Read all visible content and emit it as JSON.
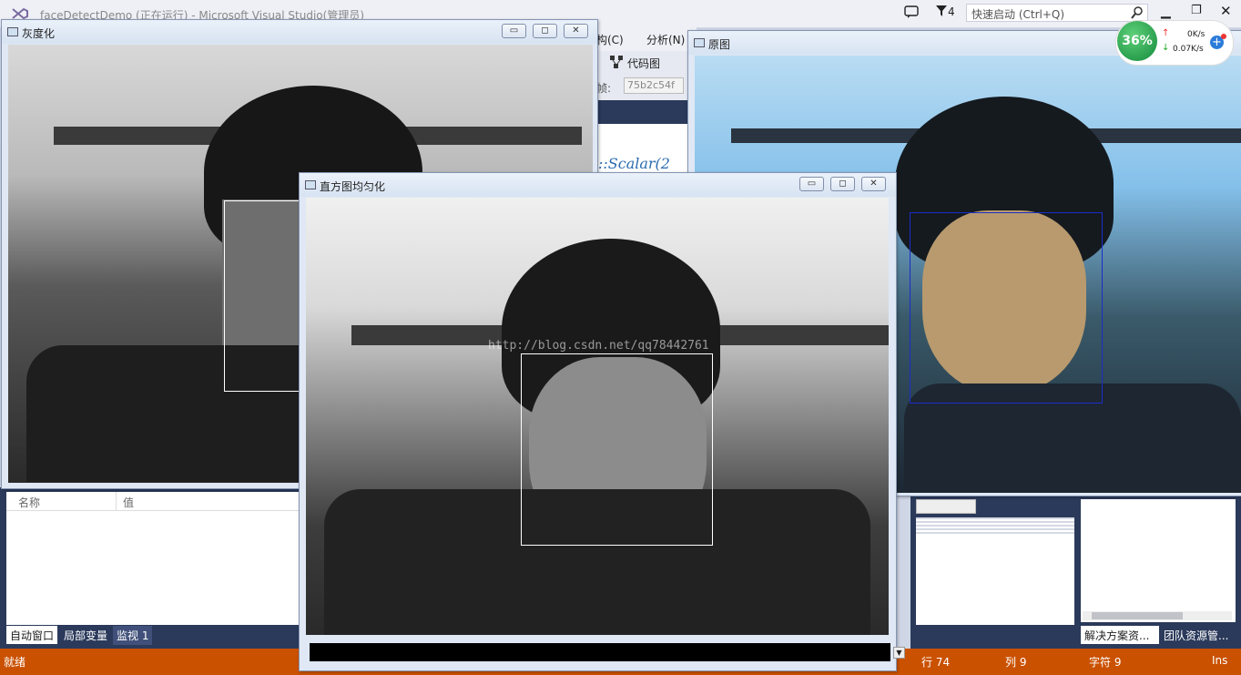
{
  "vs": {
    "title": "faceDetectDemo (正在运行) - Microsoft Visual Studio(管理员)",
    "menu_arch": "构(C)",
    "menu_analyze": "分析(N)",
    "code_map": "代码图",
    "frame_label": "帧:",
    "frame_value": "75b2c54f",
    "code_text": "::Scalar(2",
    "quick_launch_placeholder": "快速启动 (Ctrl+Q)",
    "filter_count": "4",
    "status": {
      "ready": "就绪",
      "line": "行 74",
      "col": "列 9",
      "char": "字符 9",
      "mode": "Ins"
    },
    "locals": {
      "col_name": "名称",
      "col_value": "值",
      "tabs": [
        "自动窗口",
        "局部变量",
        "监视 1"
      ]
    },
    "right_tabs": [
      "解决方案资...",
      "团队资源管..."
    ]
  },
  "netmon": {
    "percent": "36%",
    "up": "0K/s",
    "down": "0.07K/s"
  },
  "windows": {
    "gray": {
      "title": "灰度化"
    },
    "hist": {
      "title": "直方图均匀化"
    },
    "orig": {
      "title": "原图"
    }
  },
  "watermark": "http://blog.csdn.net/qq78442761",
  "colors": {
    "statusbar": "#ca5100",
    "panel_navy": "#2b3a5b",
    "facebox_orig": "#1a2ec8",
    "facebox_gray": "#ffffff"
  }
}
